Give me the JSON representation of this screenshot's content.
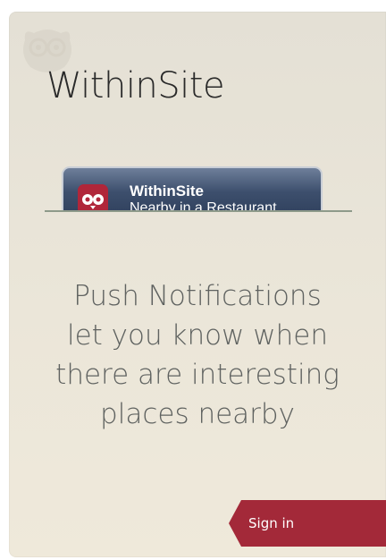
{
  "app": {
    "title": "WithinSite"
  },
  "notification_preview": {
    "title": "WithinSite",
    "subtitle": "Nearby in a Restaurant",
    "icon": "owl-app-icon"
  },
  "message": {
    "lines": [
      "Push Notifications",
      "let you know when",
      "there are interesting",
      "places nearby"
    ]
  },
  "actions": {
    "signin_label": "Sign in"
  },
  "colors": {
    "accent": "#a32939",
    "text_dark": "#2a2a2a",
    "text_muted": "#5f6260",
    "notification_bg": "#2d3d5a"
  }
}
